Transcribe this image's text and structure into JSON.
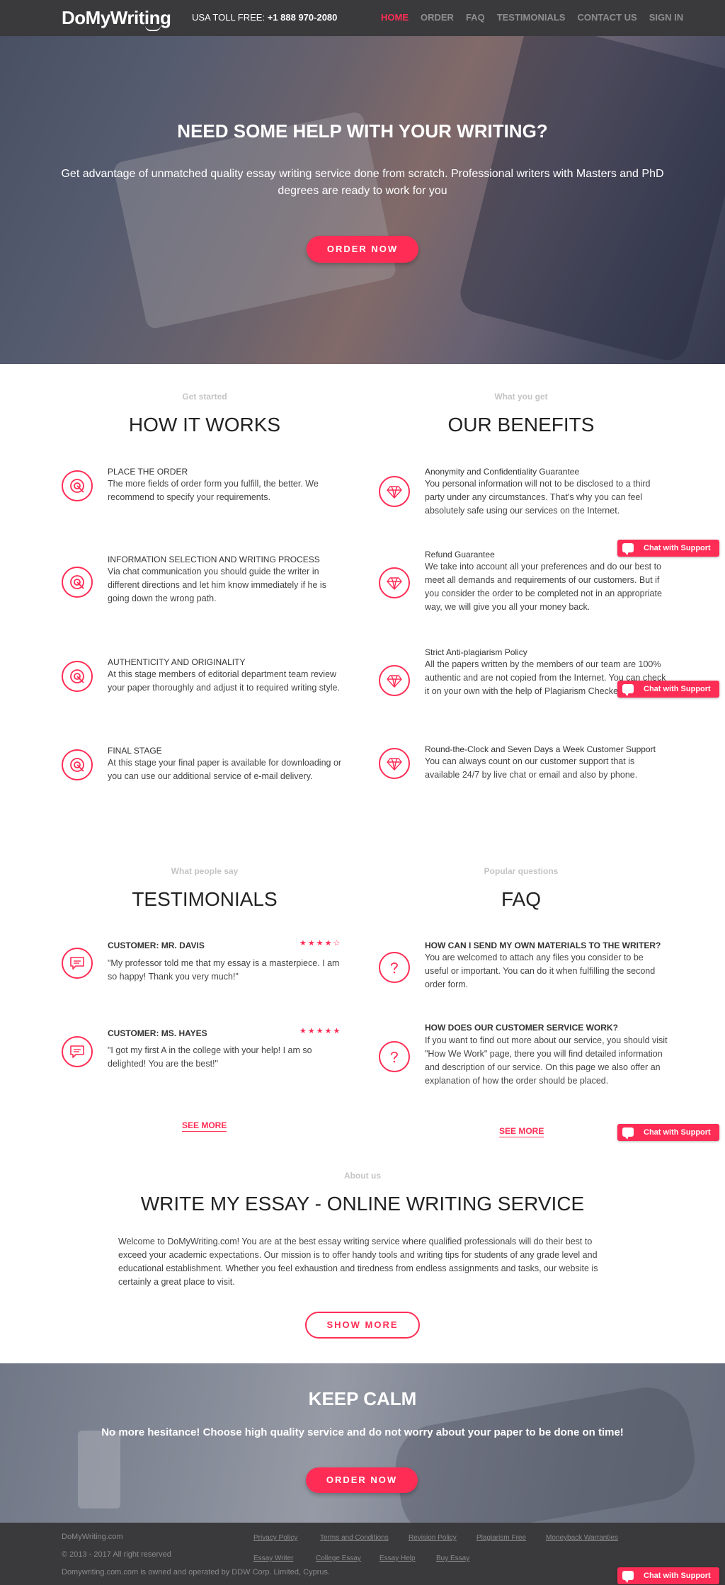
{
  "header": {
    "logo": "DoMyWriting",
    "toll_label": "USA TOLL FREE:",
    "toll_phone": "+1 888 970-2080",
    "nav": [
      "HOME",
      "ORDER",
      "FAQ",
      "TESTIMONIALS",
      "CONTACT US",
      "SIGN IN"
    ]
  },
  "hero": {
    "title": "NEED SOME HELP WITH YOUR WRITING?",
    "text": "Get advantage of unmatched quality essay writing service done from scratch. Professional writers with Masters and PhD degrees are ready to work for you",
    "button": "ORDER NOW"
  },
  "how": {
    "subtitle": "Get started",
    "title": "HOW IT WORKS",
    "items": [
      {
        "title": "PLACE THE ORDER",
        "text": "The more fields of order form you fulfill, the better. We recommend to specify your requirements."
      },
      {
        "title": "INFORMATION SELECTION AND WRITING PROCESS",
        "text": "Via chat communication you should guide the writer in different directions and let him know immediately if he is going down the wrong path."
      },
      {
        "title": "AUTHENTICITY AND ORIGINALITY",
        "text": "At this stage members of editorial department team review your paper thoroughly and adjust it to required writing style."
      },
      {
        "title": "FINAL STAGE",
        "text": "At this stage your final paper is available for downloading or you can use our additional service of e-mail delivery."
      }
    ]
  },
  "benefits": {
    "subtitle": "What you get",
    "title": "OUR BENEFITS",
    "items": [
      {
        "title": "Anonymity and Confidentiality Guarantee",
        "text": "You personal information will not to be disclosed to a third party under any circumstances. That's why you can feel absolutely safe using our services on the Internet."
      },
      {
        "title": "Refund Guarantee",
        "text": "We take into account all your preferences and do our best to meet all demands and requirements of our customers. But if you consider the order to be completed not in an appropriate way, we will give you all your money back."
      },
      {
        "title": "Strict Anti-plagiarism Policy",
        "text": "All the papers written by the members of our team are 100% authentic and are not copied from the Internet. You can check it on your own with the help of Plagiarism Checker services."
      },
      {
        "title": "Round-the-Clock and Seven Days a Week Customer Support",
        "text": "You can always count on our customer support that is available 24/7 by live chat or email and also by phone."
      }
    ]
  },
  "testimonials": {
    "subtitle": "What people say",
    "title": "TESTIMONIALS",
    "items": [
      {
        "name": "CUSTOMER: MR. DAVIS",
        "stars": "★★★★☆",
        "text": "\"My professor told me that my essay is a masterpiece. I am so happy! Thank you very much!\""
      },
      {
        "name": "CUSTOMER: MS. HAYES",
        "stars": "★★★★★",
        "text": "\"I got my first A in the college with your help! I am so delighted! You are the best!\""
      }
    ],
    "see_more": "SEE MORE"
  },
  "faq": {
    "subtitle": "Popular questions",
    "title": "FAQ",
    "items": [
      {
        "q": "HOW CAN I SEND MY OWN MATERIALS TO THE WRITER?",
        "a": "You are welcomed to attach any files you consider to be useful or important. You can do it when fulfilling the second order form."
      },
      {
        "q": "HOW DOES OUR CUSTOMER SERVICE WORK?",
        "a": "If you want to find out more about our service, you should visit \"How We Work\" page, there you will find detailed information and description of our service. On this page we also offer an explanation of how the order should be placed."
      }
    ],
    "see_more": "SEE MORE"
  },
  "about": {
    "subtitle": "About us",
    "title": "WRITE MY ESSAY - ONLINE WRITING SERVICE",
    "text": "Welcome to DoMyWriting.com! You are at the best essay writing service where qualified professionals will do their best to exceed your academic expectations. Our mission is to offer handy tools and writing tips for students of any grade level and educational establishment. Whether you feel exhaustion and tiredness from endless assignments and tasks, our website is certainly a great place to visit.",
    "button": "SHOW MORE"
  },
  "calm": {
    "title": "KEEP CALM",
    "text": "No more hesitance! Choose high quality service and do not worry about your paper to be done on time!",
    "button": "ORDER NOW"
  },
  "footer": {
    "site": "DoMyWriting.com",
    "copyright": "© 2013 - 2017 All right reserved",
    "owner": "Domywriting.com.com is owned and operated by DDW Corp. Limited, Cyprus.",
    "links_row1": [
      "Privacy Policy",
      "Terms and Conditions",
      "Revision Policy",
      "Plagiarism Free",
      "Moneyback Warranties"
    ],
    "links_row2": [
      "Essay Writer",
      "College Essay",
      "Essay Help",
      "Buy Essay"
    ]
  },
  "chat": {
    "label": "Chat with Support"
  },
  "colors": {
    "accent": "#ff2d55",
    "header_bg": "#3a3a3c"
  }
}
